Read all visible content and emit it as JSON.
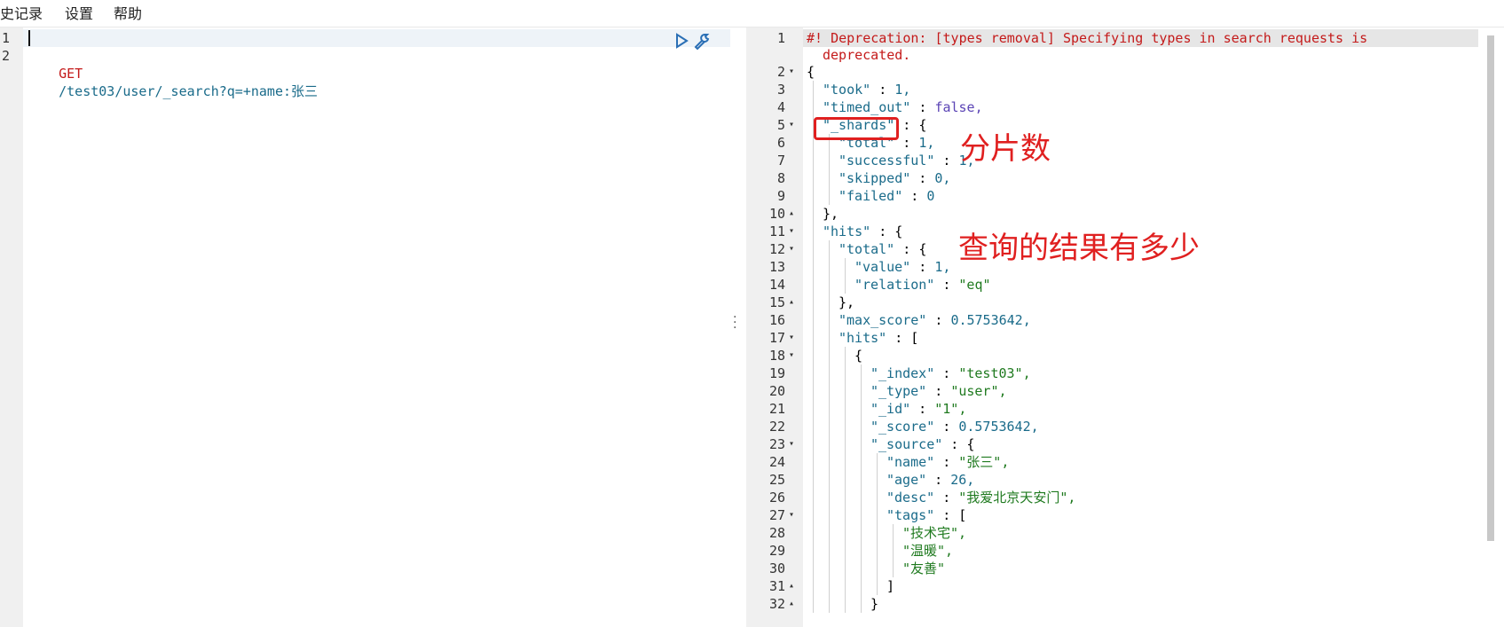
{
  "menu": {
    "history": "史记录",
    "settings": "设置",
    "help": "帮助"
  },
  "editor": {
    "line_numbers": [
      "1",
      "2"
    ],
    "request_method": "GET",
    "request_path": "/test03/user/_search?q=+name:张三"
  },
  "output": {
    "warning_line1": "#! Deprecation: [types removal] Specifying types in search requests is",
    "warning_line2": "deprecated.",
    "line_numbers": [
      "1",
      "2",
      "3",
      "4",
      "5",
      "6",
      "7",
      "8",
      "9",
      "10",
      "11",
      "12",
      "13",
      "14",
      "15",
      "16",
      "17",
      "18",
      "19",
      "20",
      "21",
      "22",
      "23",
      "24",
      "25",
      "26",
      "27",
      "28",
      "29",
      "30",
      "31",
      "32"
    ],
    "lines": [
      {
        "k": "{",
        "t": "punc",
        "indent": 0
      },
      {
        "k": "\"took\"",
        "v": "1,",
        "vt": "num",
        "indent": 1
      },
      {
        "k": "\"timed_out\"",
        "v": "false,",
        "vt": "bool",
        "indent": 1
      },
      {
        "k": "\"_shards\"",
        "v": "{",
        "vt": "punc",
        "indent": 1
      },
      {
        "k": "\"total\"",
        "v": "1,",
        "vt": "num",
        "indent": 2
      },
      {
        "k": "\"successful\"",
        "v": "1,",
        "vt": "num",
        "indent": 2
      },
      {
        "k": "\"skipped\"",
        "v": "0,",
        "vt": "num",
        "indent": 2
      },
      {
        "k": "\"failed\"",
        "v": "0",
        "vt": "num",
        "indent": 2
      },
      {
        "k": "},",
        "t": "punc",
        "indent": 1
      },
      {
        "k": "\"hits\"",
        "v": "{",
        "vt": "punc",
        "indent": 1
      },
      {
        "k": "\"total\"",
        "v": "{",
        "vt": "punc",
        "indent": 2
      },
      {
        "k": "\"value\"",
        "v": "1,",
        "vt": "num",
        "indent": 3
      },
      {
        "k": "\"relation\"",
        "v": "\"eq\"",
        "vt": "str",
        "indent": 3
      },
      {
        "k": "},",
        "t": "punc",
        "indent": 2
      },
      {
        "k": "\"max_score\"",
        "v": "0.5753642,",
        "vt": "num",
        "indent": 2
      },
      {
        "k": "\"hits\"",
        "v": "[",
        "vt": "punc",
        "indent": 2
      },
      {
        "k": "{",
        "t": "punc",
        "indent": 3
      },
      {
        "k": "\"_index\"",
        "v": "\"test03\",",
        "vt": "str",
        "indent": 4
      },
      {
        "k": "\"_type\"",
        "v": "\"user\",",
        "vt": "str",
        "indent": 4
      },
      {
        "k": "\"_id\"",
        "v": "\"1\",",
        "vt": "str",
        "indent": 4
      },
      {
        "k": "\"_score\"",
        "v": "0.5753642,",
        "vt": "num",
        "indent": 4
      },
      {
        "k": "\"_source\"",
        "v": "{",
        "vt": "punc",
        "indent": 4
      },
      {
        "k": "\"name\"",
        "v": "\"张三\",",
        "vt": "str",
        "indent": 5
      },
      {
        "k": "\"age\"",
        "v": "26,",
        "vt": "num",
        "indent": 5
      },
      {
        "k": "\"desc\"",
        "v": "\"我爱北京天安门\",",
        "vt": "str",
        "indent": 5
      },
      {
        "k": "\"tags\"",
        "v": "[",
        "vt": "punc",
        "indent": 5
      },
      {
        "k": "\"技术宅\",",
        "t": "str",
        "indent": 6
      },
      {
        "k": "\"温暖\",",
        "t": "str",
        "indent": 6
      },
      {
        "k": "\"友善\"",
        "t": "str",
        "indent": 6
      },
      {
        "k": "]",
        "t": "punc",
        "indent": 5
      },
      {
        "k": "}",
        "t": "punc",
        "indent": 4
      }
    ],
    "fold_down": [
      "2",
      "5",
      "11",
      "12",
      "17",
      "18",
      "23",
      "27"
    ],
    "fold_up": [
      "10",
      "15",
      "31",
      "32"
    ]
  },
  "annotations": {
    "shards_note": "分片数",
    "hits_note": "查询的结果有多少"
  },
  "colors": {
    "annotation": "#e02020",
    "warning": "#c41a1a",
    "string": "#1f7a1f",
    "key": "#1a6b8a",
    "bool": "#5b44b5"
  },
  "icons": {
    "run": "play-icon",
    "settings": "wrench-icon"
  }
}
